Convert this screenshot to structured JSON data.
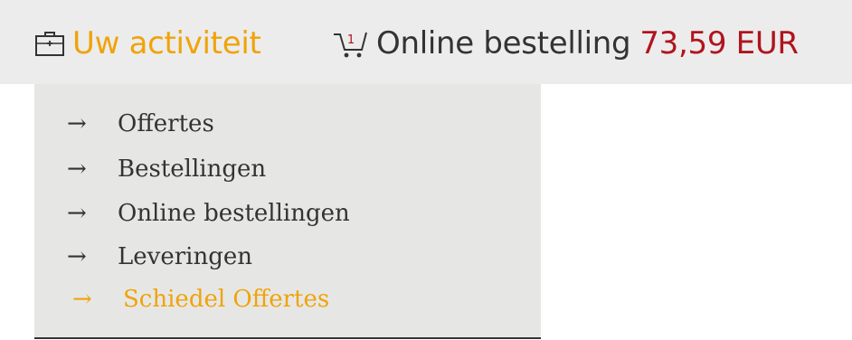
{
  "header": {
    "activity_label": "Uw activiteit",
    "activity_icon": "briefcase-icon",
    "order_label": "Online bestelling",
    "order_total": "73,59 EUR",
    "cart_icon": "cart-icon",
    "cart_count": "1"
  },
  "menu": {
    "arrow": "→",
    "items": [
      {
        "label": "Offertes"
      },
      {
        "label": "Bestellingen"
      },
      {
        "label": "Online bestellingen"
      },
      {
        "label": "Leveringen"
      },
      {
        "label": "Schiedel Offertes"
      }
    ],
    "active_index": 4
  },
  "colors": {
    "accent": "#f0a30a",
    "price": "#b0141e",
    "text": "#333333",
    "bar_bg": "#ececec",
    "menu_bg": "#e6e7e5"
  }
}
